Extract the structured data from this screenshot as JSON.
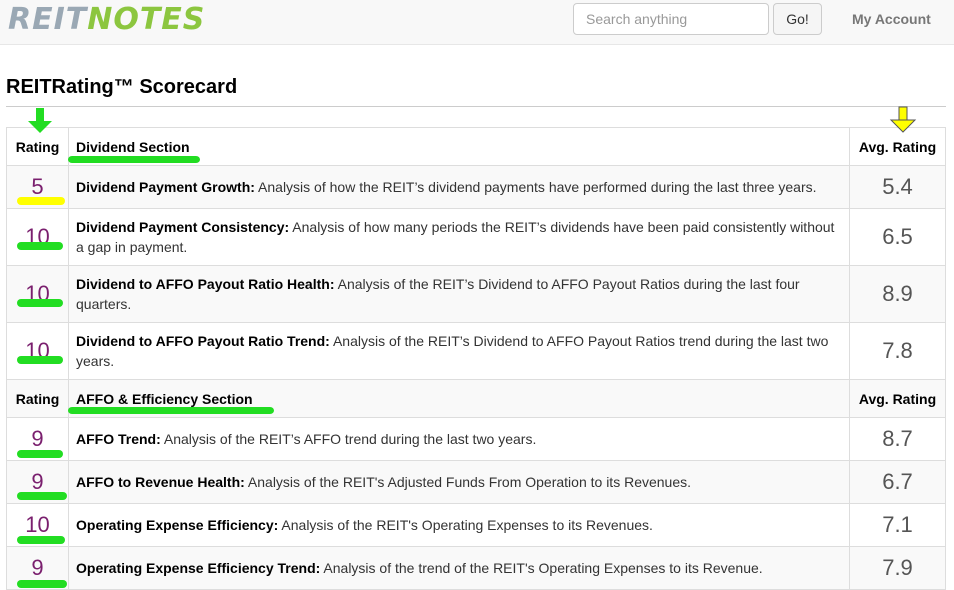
{
  "header": {
    "logo_reit": "REIT",
    "logo_notes": "NOTES",
    "search_placeholder": "Search anything",
    "go_label": "Go!",
    "account_label": "My Account"
  },
  "page_title": "REITRating™ Scorecard",
  "colors": {
    "highlight_green": "#22dd22",
    "highlight_yellow": "#ffff00",
    "rating_purple": "#7a1f6e"
  },
  "sections": [
    {
      "rating_header": "Rating",
      "name": "Dividend Section",
      "avg_header": "Avg. Rating",
      "rows": [
        {
          "rating": "5",
          "title": "Dividend Payment Growth:",
          "desc": " Analysis of how the REIT’s dividend payments have performed during the last three years.",
          "avg": "5.4"
        },
        {
          "rating": "10",
          "title": "Dividend Payment Consistency:",
          "desc": " Analysis of how many periods the REIT’s dividends have been paid consistently without a gap in payment.",
          "avg": "6.5"
        },
        {
          "rating": "10",
          "title": "Dividend to AFFO Payout Ratio Health:",
          "desc": " Analysis of the REIT’s Dividend to AFFO Payout Ratios during the last four quarters.",
          "avg": "8.9"
        },
        {
          "rating": "10",
          "title": "Dividend to AFFO Payout Ratio Trend:",
          "desc": " Analysis of the REIT’s Dividend to AFFO Payout Ratios trend during the last two years.",
          "avg": "7.8"
        }
      ]
    },
    {
      "rating_header": "Rating",
      "name": "AFFO & Efficiency Section",
      "avg_header": "Avg. Rating",
      "rows": [
        {
          "rating": "9",
          "title": "AFFO Trend:",
          "desc": " Analysis of the REIT’s AFFO trend during the last two years.",
          "avg": "8.7"
        },
        {
          "rating": "9",
          "title": "AFFO to Revenue Health:",
          "desc": " Analysis of the REIT's Adjusted Funds From Operation to its Revenues.",
          "avg": "6.7"
        },
        {
          "rating": "10",
          "title": "Operating Expense Efficiency:",
          "desc": " Analysis of the REIT's Operating Expenses to its Revenues.",
          "avg": "7.1"
        },
        {
          "rating": "9",
          "title": "Operating Expense Efficiency Trend:",
          "desc": " Analysis of the trend of the REIT's Operating Expenses to its Revenue.",
          "avg": "7.9"
        }
      ]
    }
  ]
}
